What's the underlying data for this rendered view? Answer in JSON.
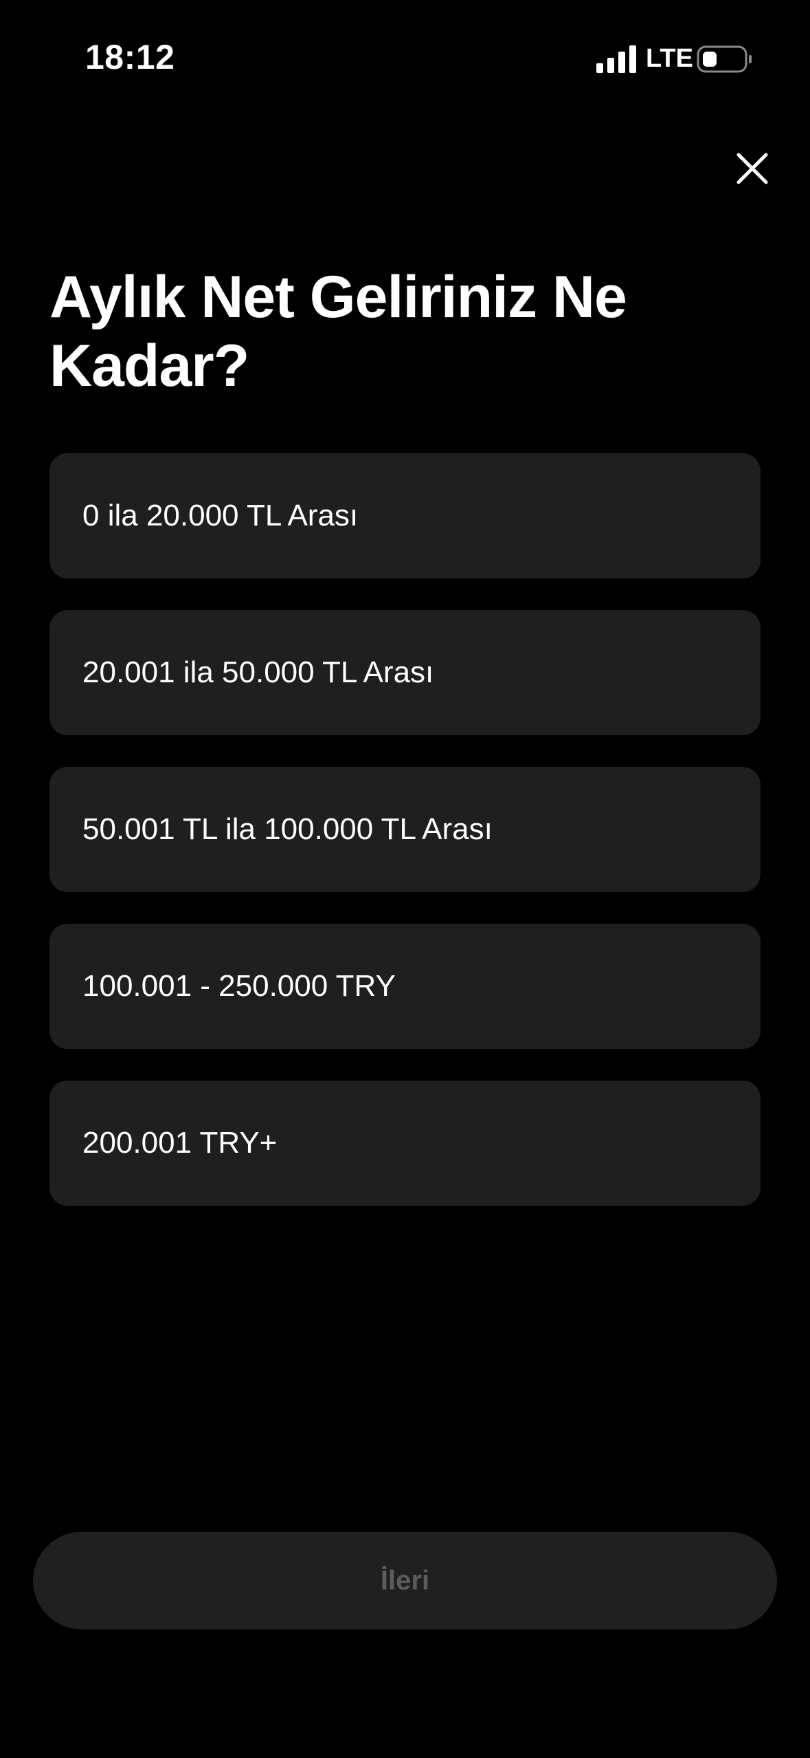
{
  "status_bar": {
    "time": "18:12",
    "network": "LTE",
    "signal_icon": "cellular-signal-icon",
    "battery_icon": "battery-icon"
  },
  "header": {
    "close_icon": "close-icon"
  },
  "question": {
    "title": "Aylık Net Geliriniz Ne Kadar?"
  },
  "options": [
    {
      "label": "0 ila 20.000 TL Arası"
    },
    {
      "label": "20.001 ila 50.000 TL Arası"
    },
    {
      "label": "50.001 TL ila 100.000 TL Arası"
    },
    {
      "label": "100.001 - 250.000 TRY"
    },
    {
      "label": "200.001 TRY+"
    }
  ],
  "footer": {
    "next_label": "İleri"
  },
  "colors": {
    "background": "#000000",
    "card": "#1f1f1f",
    "button": "#202020",
    "button_text_disabled": "#5c5c5c",
    "text": "#ffffff"
  }
}
